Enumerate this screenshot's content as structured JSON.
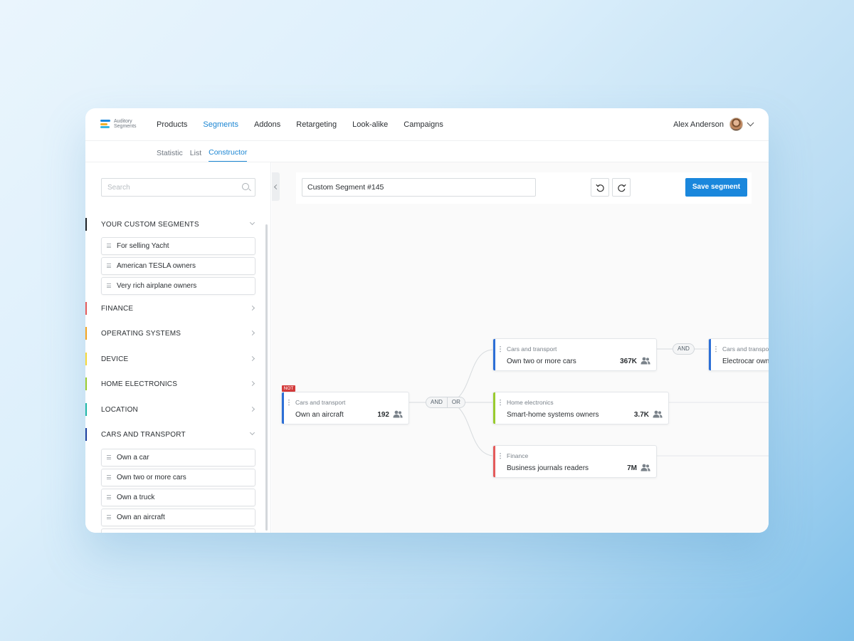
{
  "logo": {
    "text_line1": "Auditory",
    "text_line2": "Segments",
    "colors": [
      "#1a87dc",
      "#f2b12a",
      "#38b6e0"
    ]
  },
  "nav": {
    "items": [
      "Products",
      "Segments",
      "Addons",
      "Retargeting",
      "Look-alike",
      "Campaigns"
    ],
    "active": "Segments"
  },
  "user": {
    "name": "Alex Anderson"
  },
  "subtabs": {
    "items": [
      "Statistic",
      "List",
      "Constructor"
    ],
    "active": "Constructor"
  },
  "sidebar": {
    "search_placeholder": "Search",
    "custom": {
      "title": "YOUR CUSTOM SEGMENTS",
      "color": "#1e2226",
      "items": [
        "For selling Yacht",
        "American TESLA owners",
        "Very rich airplane owners"
      ]
    },
    "categories": [
      {
        "label": "FINANCE",
        "color": "#e45b5b"
      },
      {
        "label": "OPERATING SYSTEMS",
        "color": "#f2a321"
      },
      {
        "label": "DEVICE",
        "color": "#f5d83a"
      },
      {
        "label": "HOME ELECTRONICS",
        "color": "#9acb2f"
      },
      {
        "label": "LOCATION",
        "color": "#1fb7a7"
      }
    ],
    "cars": {
      "title": "CARS AND TRANSPORT",
      "color": "#1c3f9e",
      "items": [
        "Own a car",
        "Own two or more cars",
        "Own a truck",
        "Own an aircraft"
      ]
    }
  },
  "toolbar": {
    "segment_name": "Custom Segment #145",
    "save_label": "Save segment"
  },
  "canvas": {
    "not_label": "NOT",
    "logic_and": "AND",
    "logic_or": "OR",
    "logic_and2": "AND",
    "nodes": {
      "root": {
        "category": "Cars and transport",
        "title": "Own an aircraft",
        "count": "192",
        "color": "#2d6fd6"
      },
      "n1": {
        "category": "Cars and transport",
        "title": "Own two or more cars",
        "count": "367K",
        "color": "#2d6fd6"
      },
      "n2": {
        "category": "Home electronics",
        "title": "Smart-home systems owners",
        "count": "3.7K",
        "color": "#9acb2f"
      },
      "n3": {
        "category": "Finance",
        "title": "Business journals readers",
        "count": "7M",
        "color": "#e45b5b"
      },
      "n4": {
        "category": "Cars and transport",
        "title": "Electrocar owners",
        "color": "#2d6fd6"
      }
    }
  }
}
